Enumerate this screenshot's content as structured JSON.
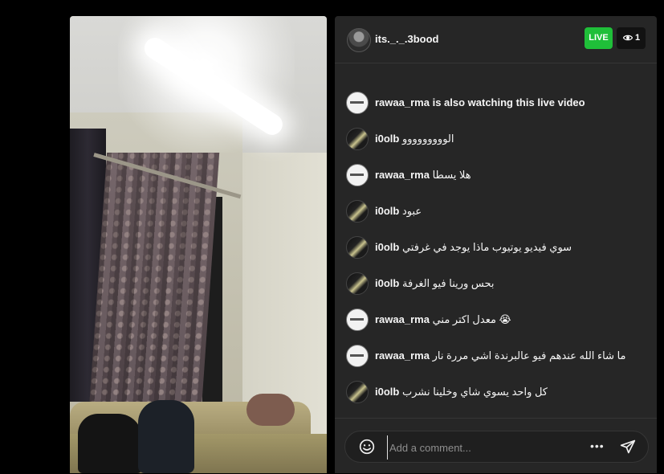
{
  "header": {
    "host_username": "its._._.3bood",
    "live_label": "LIVE",
    "viewer_count": "1"
  },
  "comments": [
    {
      "username": "rawaa_rma",
      "text": "is also watching this live video",
      "avatar": "rawaa-avatar"
    },
    {
      "username": "i0olb",
      "text": "الووووووووو",
      "avatar": "i0olb-avatar"
    },
    {
      "username": "rawaa_rma",
      "text": "هلا يسطا",
      "avatar": "rawaa-avatar"
    },
    {
      "username": "i0olb",
      "text": "عبود",
      "avatar": "i0olb-avatar"
    },
    {
      "username": "i0olb",
      "text": "سوي فيديو يوتيوب ماذا يوجد في غرفتي",
      "avatar": "i0olb-avatar"
    },
    {
      "username": "i0olb",
      "text": "بحس ورينا فيو الغرفة",
      "avatar": "i0olb-avatar"
    },
    {
      "username": "rawaa_rma",
      "text": "معدل اكتر مني 😭",
      "avatar": "rawaa-avatar"
    },
    {
      "username": "rawaa_rma",
      "text": "ما شاء الله عندهم فيو عالبرندة اشي مررة نار",
      "avatar": "rawaa-avatar"
    },
    {
      "username": "i0olb",
      "text": "كل واحد يسوي شاي وخلينا نشرب",
      "avatar": "i0olb-avatar"
    }
  ],
  "footer": {
    "comment_placeholder": "Add a comment...",
    "more_label": "•••"
  },
  "icons": {
    "eye": "eye-icon",
    "emoji": "emoji-icon",
    "more": "more-options-icon",
    "send": "send-icon"
  },
  "colors": {
    "live": "#1fbf39",
    "panel_bg": "#262626",
    "page_bg": "#000000"
  }
}
